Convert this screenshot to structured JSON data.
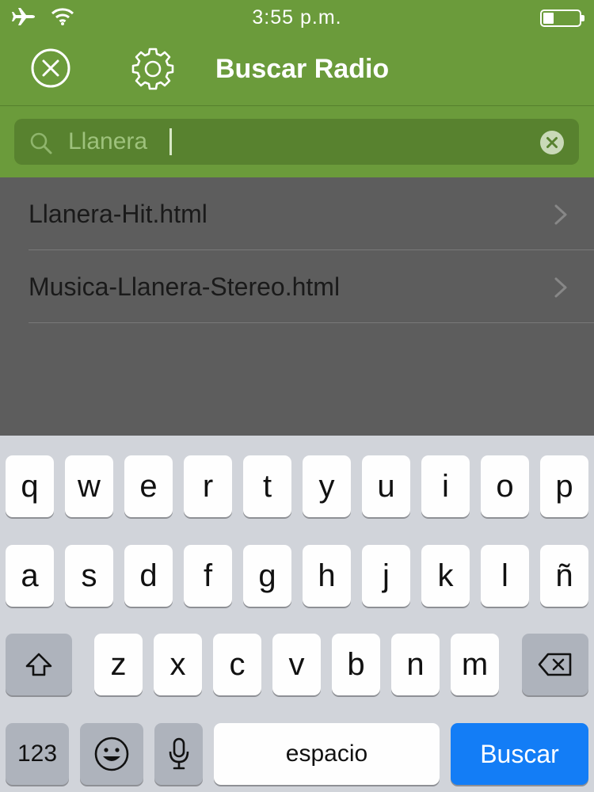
{
  "status": {
    "time": "3:55 p.m.",
    "airplane_icon": "airplane-icon",
    "wifi_icon": "wifi-icon",
    "battery_icon": "battery-icon",
    "battery_level": 0.3
  },
  "nav": {
    "title": "Buscar Radio",
    "close_icon": "close-circle-icon",
    "settings_icon": "gear-icon"
  },
  "search": {
    "value": "Llanera",
    "search_icon": "search-icon",
    "clear_icon": "clear-icon"
  },
  "results": [
    {
      "label": "Llanera-Hit.html"
    },
    {
      "label": "Musica-Llanera-Stereo.html"
    }
  ],
  "keyboard": {
    "row1": [
      "q",
      "w",
      "e",
      "r",
      "t",
      "y",
      "u",
      "i",
      "o",
      "p"
    ],
    "row2": [
      "a",
      "s",
      "d",
      "f",
      "g",
      "h",
      "j",
      "k",
      "l",
      "ñ"
    ],
    "row3": [
      "z",
      "x",
      "c",
      "v",
      "b",
      "n",
      "m"
    ],
    "numbers_label": "123",
    "space_label": "espacio",
    "search_label": "Buscar",
    "shift_icon": "shift-icon",
    "delete_icon": "backspace-icon",
    "emoji_icon": "emoji-icon",
    "mic_icon": "microphone-icon"
  },
  "colors": {
    "header_green": "#6b9b3b",
    "search_field": "#58822f",
    "overlay": "#5d5d5d",
    "keyboard_bg": "#d1d4da",
    "search_key_blue": "#137df6"
  }
}
